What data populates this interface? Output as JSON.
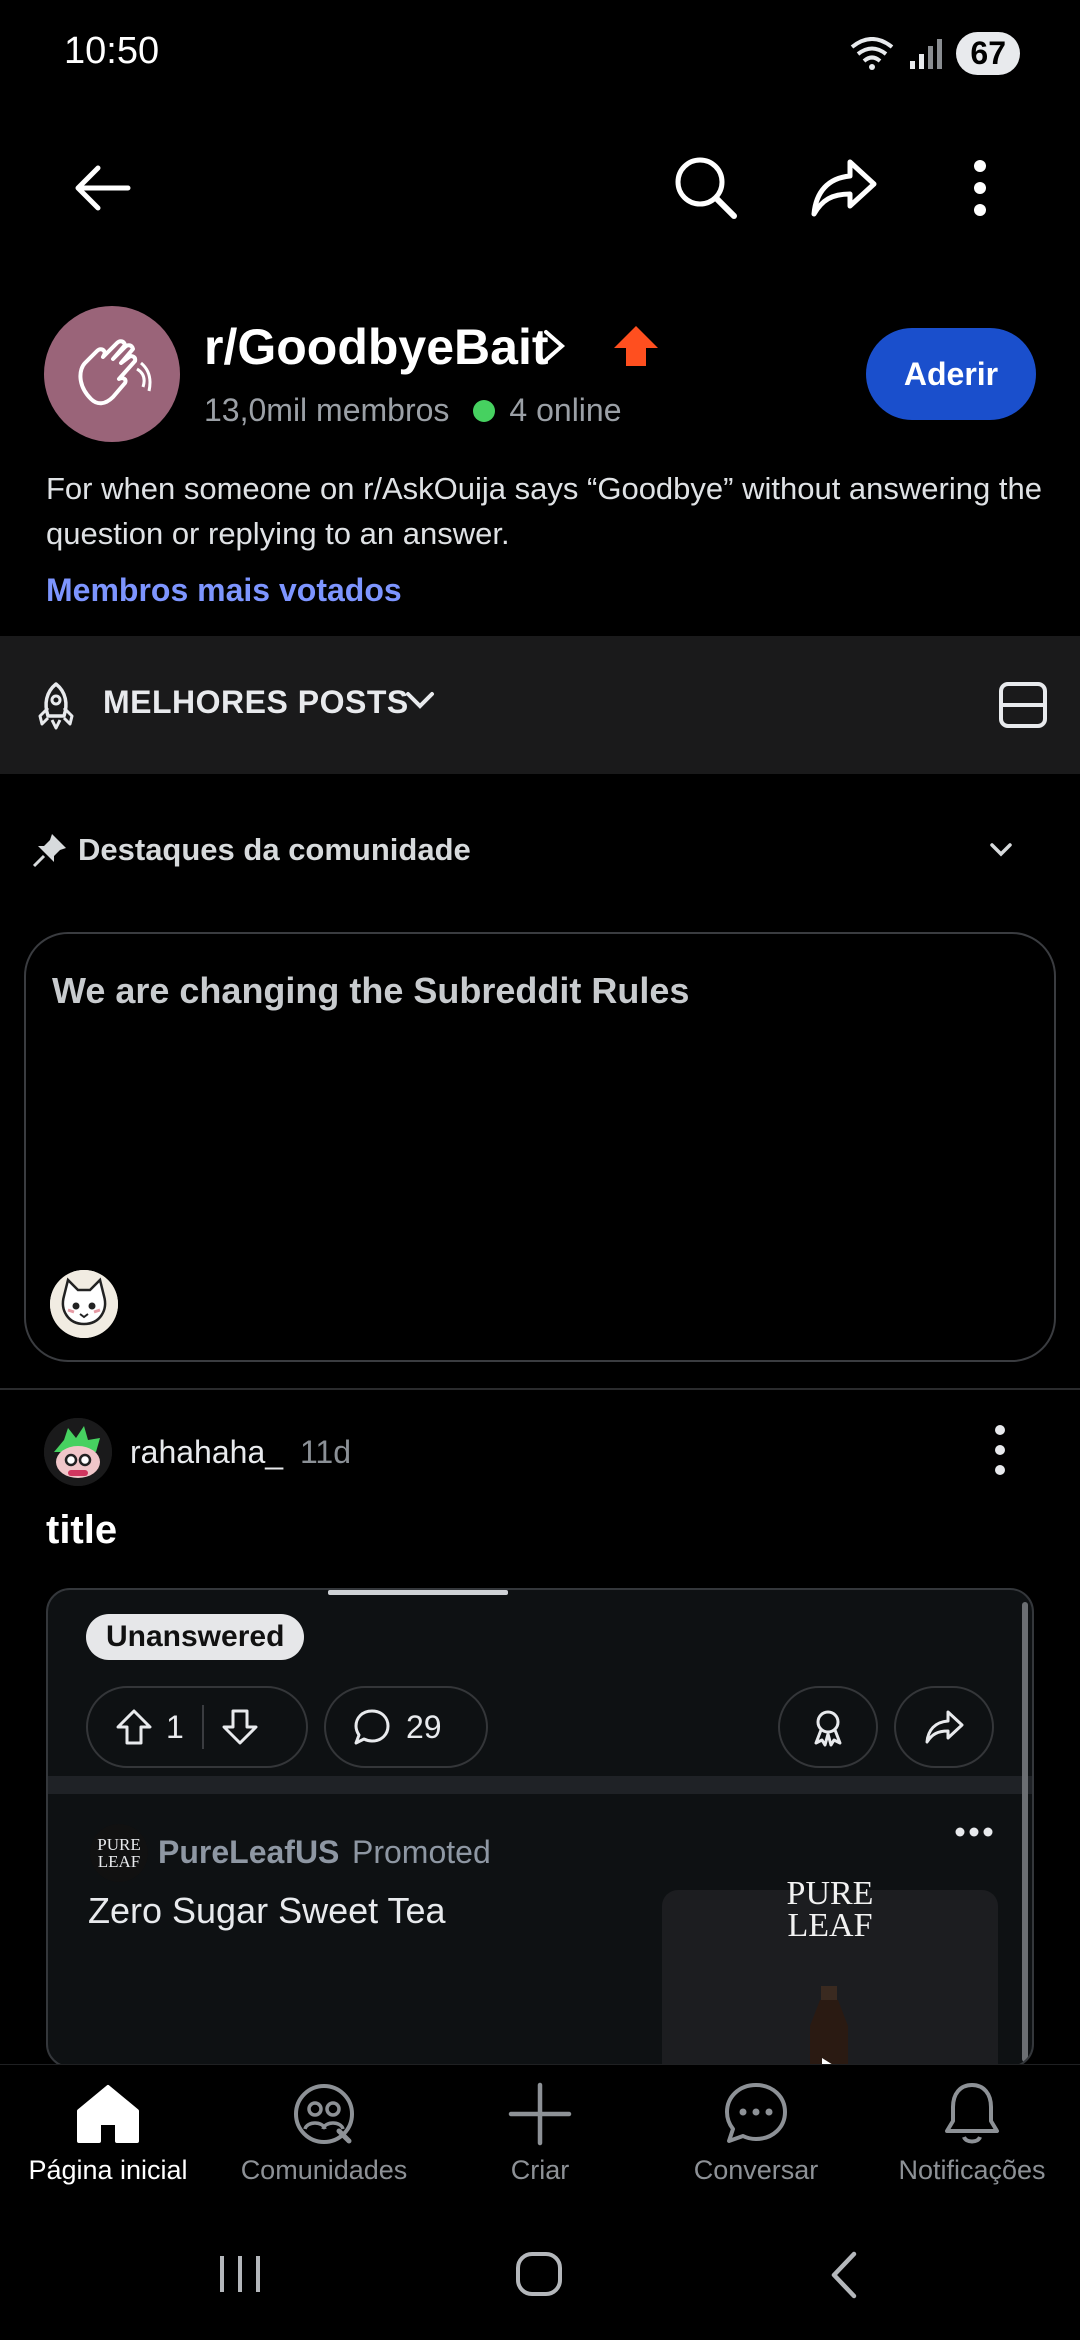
{
  "status_bar": {
    "time": "10:50",
    "battery": "67"
  },
  "toolbar": {
    "back_icon": "arrow-left-icon",
    "search_icon": "search-icon",
    "share_icon": "share-icon",
    "more_icon": "more-vertical-icon"
  },
  "community": {
    "name": "r/GoodbyeBait",
    "members": "13,0mil membros",
    "online": "4 online",
    "join_label": "Aderir",
    "description": "For when someone on r/AskOuija says “Goodbye” without answering the question or replying to an answer.",
    "top_members_link": "Membros mais votados",
    "accent_color": "#1a4fcc",
    "avatar_color": "#9a6479"
  },
  "sort": {
    "label": "MELHORES POSTS"
  },
  "highlights": {
    "header": "Destaques da comunidade",
    "card_title": "We are changing the Subreddit Rules"
  },
  "post": {
    "author": "rahahaha_",
    "age": "11d",
    "title": "title",
    "image": {
      "flair": "Unanswered",
      "votes": "1",
      "comments": "29",
      "promo_name": "PureLeafUS",
      "promo_tag": "Promoted",
      "promo_title": "Zero Sugar Sweet Tea",
      "promo_logo_line1": "PURE",
      "promo_logo_line2": "LEAF"
    }
  },
  "bottom_nav": {
    "items": [
      {
        "label": "Página inicial",
        "icon": "home-icon",
        "active": true
      },
      {
        "label": "Comunidades",
        "icon": "communities-icon"
      },
      {
        "label": "Criar",
        "icon": "plus-icon"
      },
      {
        "label": "Conversar",
        "icon": "chat-icon"
      },
      {
        "label": "Notificações",
        "icon": "bell-icon"
      }
    ]
  }
}
